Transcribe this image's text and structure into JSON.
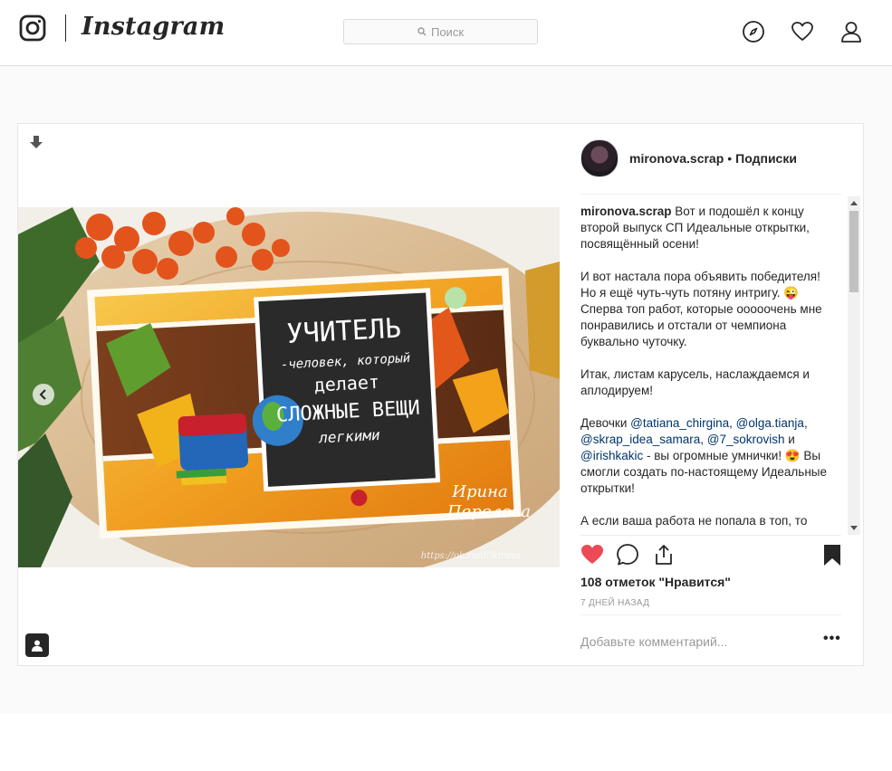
{
  "header": {
    "brand": "Instagram",
    "search_placeholder": "Поиск",
    "nav_icons": [
      "compass-icon",
      "heart-icon",
      "person-icon"
    ]
  },
  "post": {
    "username": "mironova.scrap",
    "separator": "•",
    "follow_label": "Подписки",
    "image_text": {
      "big": "УЧИТЕЛЬ",
      "sub": "-человек, который",
      "line3": "делает",
      "line4": "СЛОЖНЫЕ ВЕЩИ",
      "line5": "легкими",
      "signature_1": "Ирина",
      "signature_2": "Перелова",
      "watermark": "https://ok.ru/dilkirova"
    },
    "caption": {
      "user": "mironova.scrap",
      "p1": " Вот и подошёл к концу второй выпуск СП Идеальные открытки, посвящённый осени!",
      "p2": "И вот настала пора объявить победителя! Но я ещё чуть-чуть потяну интригу. 😜 Сперва топ работ, которые ооооочень мне понравились и отстали от чемпиона буквально чуточку.",
      "p3": "Итак, листам карусель, наслаждаемся и аплодируем!",
      "p4_prefix": "Девочки ",
      "mention1": "@tatiana_chirgina",
      "comma1": ", ",
      "mention2": "@olga.tianja",
      "comma2": ", ",
      "mention3": "@skrap_idea_samara",
      "comma3": ", ",
      "mention4": "@7_sokrovish",
      "and": " и ",
      "mention5": "@irishkakic",
      "p4_suffix": " - вы огромные умнички! 😍 Вы смогли создать по-настоящему Идеальные открытки!",
      "p5": "А если ваша работа не попала в топ, то"
    },
    "likes_text": "108 отметок \"Нравится\"",
    "time_text": "7 ДНЕЙ НАЗАД",
    "comment_placeholder": "Добавьте комментарий...",
    "more_label": "•••",
    "colors": {
      "like_red": "#ed4956",
      "mention_blue": "#003569",
      "border": "#dbdbdb"
    }
  }
}
